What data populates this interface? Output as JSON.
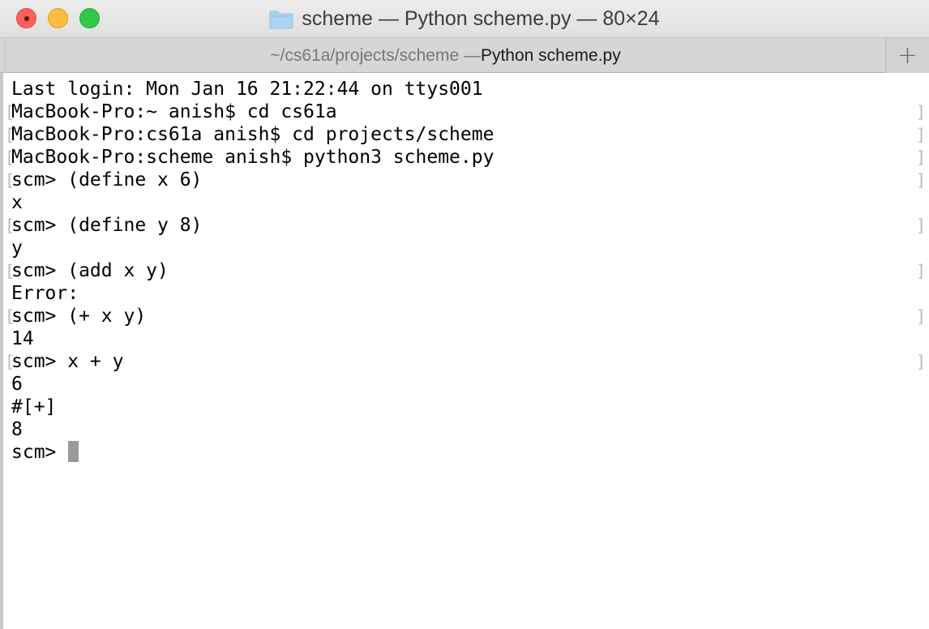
{
  "window": {
    "title": "scheme — Python scheme.py — 80×24",
    "folder_icon": "folder-icon",
    "colors": {
      "close": "#fc605c",
      "minimize": "#fdbc40",
      "maximize": "#34c84a"
    }
  },
  "tab": {
    "path": "~/cs61a/projects/scheme — ",
    "app": "Python scheme.py",
    "new_tab": "+"
  },
  "terminal": {
    "lines": [
      "Last login: Mon Jan 16 21:22:44 on ttys001",
      "MacBook-Pro:~ anish$ cd cs61a",
      "MacBook-Pro:cs61a anish$ cd projects/scheme",
      "MacBook-Pro:scheme anish$ python3 scheme.py",
      "scm> (define x 6)",
      "x",
      "scm> (define y 8)",
      "y",
      "scm> (add x y)",
      "Error:",
      "scm> (+ x y)",
      "14",
      "scm> x + y",
      "6",
      "#[+]",
      "8"
    ],
    "prompt": "scm> "
  }
}
